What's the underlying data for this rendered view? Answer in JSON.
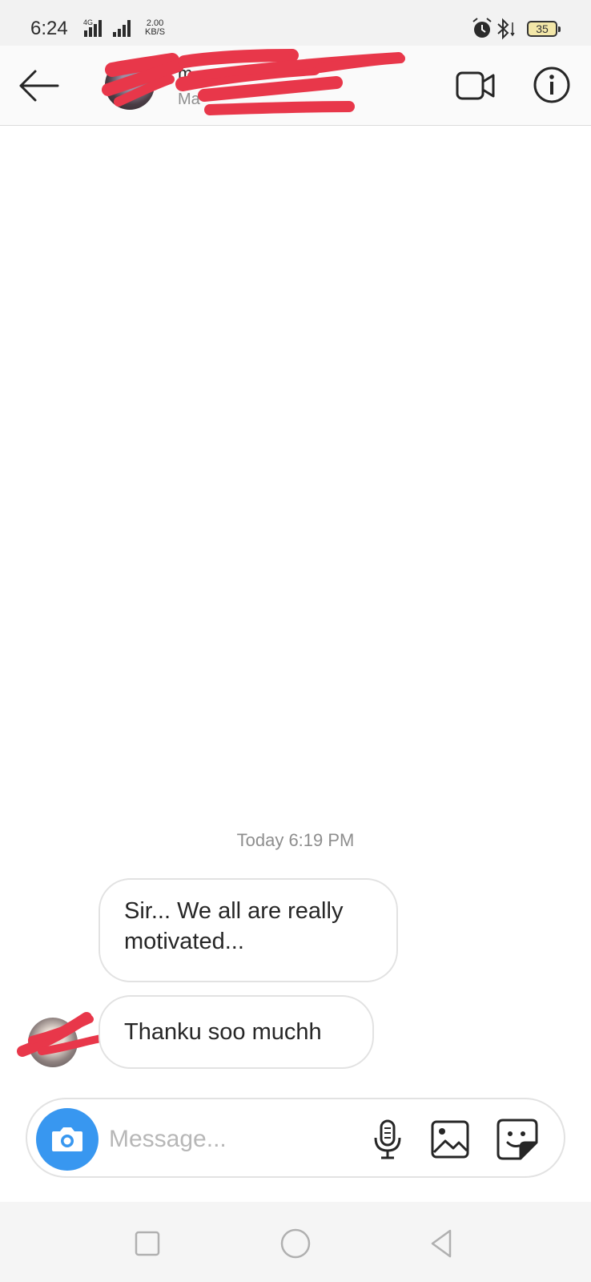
{
  "status_bar": {
    "time": "6:24",
    "network_type": "4G",
    "data_speed_value": "2.00",
    "data_speed_unit": "KB/S",
    "battery": "35",
    "icons": [
      "signal-icon",
      "signal-icon",
      "alarm-icon",
      "bluetooth-icon",
      "battery-icon"
    ]
  },
  "header": {
    "name_partial": "m",
    "subtitle_partial": "Ma",
    "icons": [
      "back-arrow-icon",
      "video-camera-icon",
      "info-icon"
    ]
  },
  "chat": {
    "timestamp": "Today 6:19 PM",
    "messages": [
      {
        "text": "Sir... We all are really motivated..."
      },
      {
        "text": "Thanku soo muchh"
      }
    ]
  },
  "composer": {
    "placeholder": "Message...",
    "icons": [
      "camera-icon",
      "microphone-icon",
      "gallery-icon",
      "sticker-icon"
    ]
  },
  "colors": {
    "accent": "#3897f0",
    "redaction": "#e8374a",
    "bubble_border": "#e2e2e2",
    "secondary_text": "#8e8e8e"
  },
  "nav": {
    "icons": [
      "recent-apps-icon",
      "home-icon",
      "back-icon"
    ]
  }
}
